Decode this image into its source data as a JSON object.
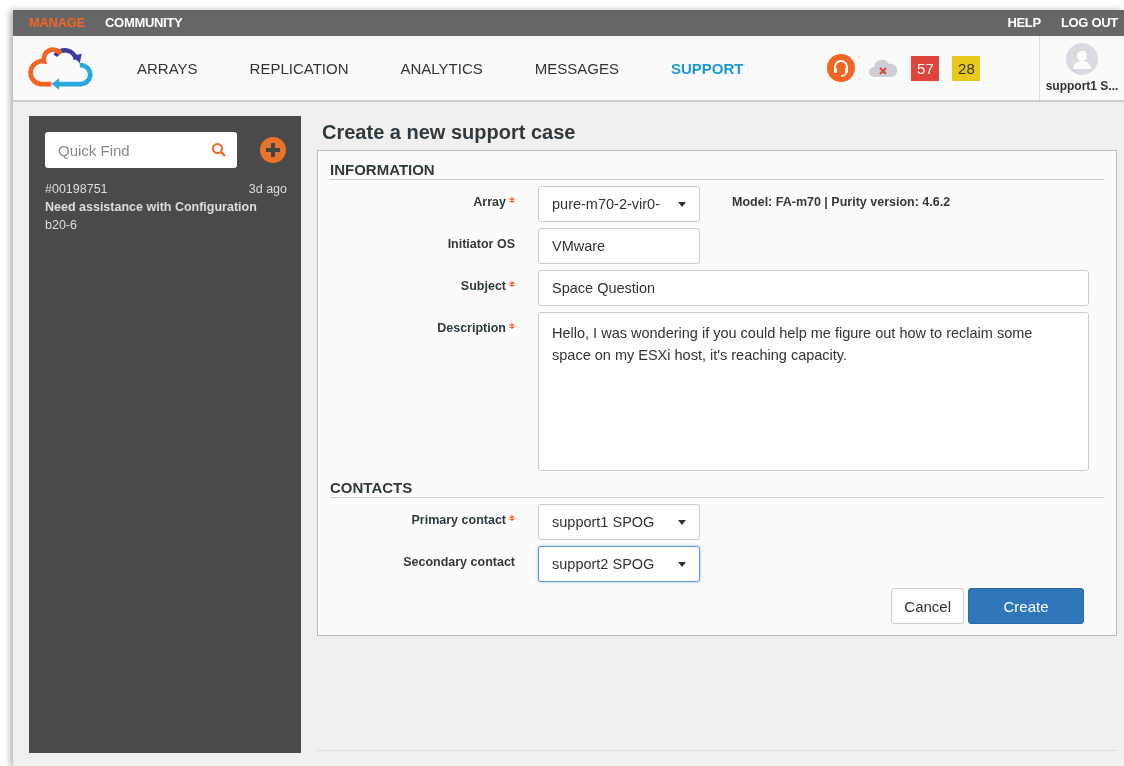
{
  "top_bar": {
    "left_links": [
      {
        "label": "MANAGE",
        "selected": true
      },
      {
        "label": "COMMUNITY",
        "selected": false
      }
    ],
    "right_links": [
      "HELP",
      "LOG OUT"
    ]
  },
  "nav": {
    "items": [
      {
        "label": "ARRAYS",
        "selected": false
      },
      {
        "label": "REPLICATION",
        "selected": false
      },
      {
        "label": "ANALYTICS",
        "selected": false
      },
      {
        "label": "MESSAGES",
        "selected": false
      },
      {
        "label": "SUPPORT",
        "selected": true
      }
    ],
    "badges": [
      {
        "count": "57",
        "color": "#e0443a"
      },
      {
        "count": "28",
        "color": "#e8c81a"
      }
    ],
    "user": "support1 S..."
  },
  "sidebar": {
    "search": {
      "placeholder": "Quick Find"
    },
    "cases": [
      {
        "number": "#00198751",
        "age": "3d ago",
        "title": "Need assistance with Configuration",
        "array": "b20-6"
      }
    ]
  },
  "page_title": "Create a new support case",
  "sections": [
    {
      "title": "INFORMATION",
      "fields": [
        {
          "label": "Array",
          "required": true,
          "kind": "select",
          "value": "pure-m70-2-vir0-",
          "focused": false,
          "note": "Model: FA-m70 | Purity version: 4.6.2"
        },
        {
          "label": "Initiator OS",
          "required": false,
          "kind": "text",
          "value": "VMware",
          "focused": false
        },
        {
          "label": "Subject",
          "required": true,
          "kind": "wide",
          "value": "Space Question",
          "focused": false
        },
        {
          "label": "Description",
          "required": true,
          "kind": "textarea",
          "value": "Hello, I was wondering if you could help me figure out how to reclaim some space on my ESXi host, it's reaching capacity.",
          "focused": false
        }
      ]
    },
    {
      "title": "CONTACTS",
      "fields": [
        {
          "label": "Primary contact",
          "required": true,
          "kind": "select",
          "value": "support1 SPOG",
          "focused": false
        },
        {
          "label": "Secondary contact",
          "required": false,
          "kind": "select",
          "value": "support2 SPOG",
          "focused": true
        }
      ]
    }
  ],
  "buttons": [
    {
      "label": "Cancel",
      "kind": "secondary"
    },
    {
      "label": "Create",
      "kind": "primary"
    }
  ]
}
